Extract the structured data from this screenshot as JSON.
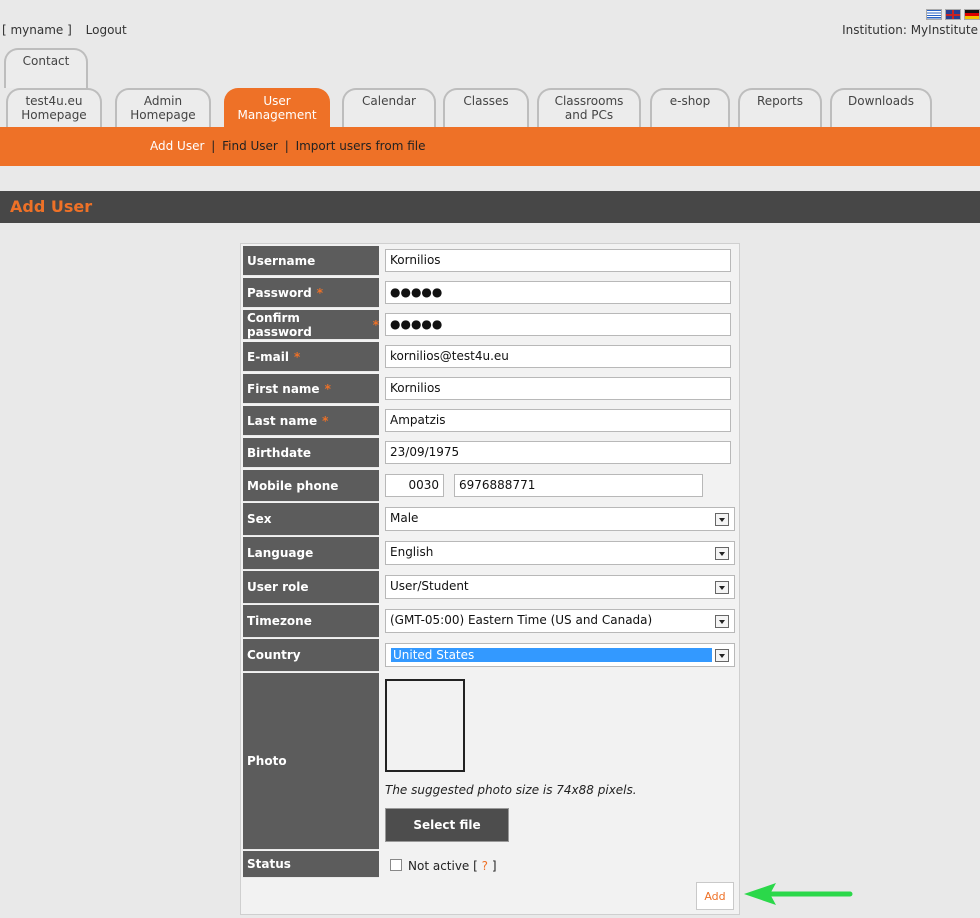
{
  "top": {
    "user": "[ myname ]",
    "logout": "Logout",
    "institution": "Institution: MyInstitute",
    "flags": [
      "greek-flag-icon",
      "english-flag-icon",
      "german-flag-icon"
    ]
  },
  "tabs": {
    "contact": "Contact",
    "items": [
      {
        "l1": "test4u.eu",
        "l2": "Homepage"
      },
      {
        "l1": "Admin",
        "l2": "Homepage"
      },
      {
        "l1": "User",
        "l2": "Management"
      },
      {
        "l1": "Calendar",
        "l2": ""
      },
      {
        "l1": "Classes",
        "l2": ""
      },
      {
        "l1": "Classrooms",
        "l2": "and PCs"
      },
      {
        "l1": "e-shop",
        "l2": ""
      },
      {
        "l1": "Reports",
        "l2": ""
      },
      {
        "l1": "Downloads",
        "l2": ""
      }
    ],
    "active_index": 2
  },
  "subnav": {
    "add_user": "Add User",
    "sep": "|",
    "find_user": "Find User",
    "import": "Import users from file"
  },
  "page": {
    "title": "Add User"
  },
  "form": {
    "required_mark": "*",
    "username": {
      "label": "Username",
      "value": "Kornilios"
    },
    "password": {
      "label": "Password",
      "value": "●●●●●"
    },
    "confirm": {
      "label": "Confirm password",
      "value": "●●●●●"
    },
    "email": {
      "label": "E-mail",
      "value": "kornilios@test4u.eu"
    },
    "first_name": {
      "label": "First name",
      "value": "Kornilios"
    },
    "last_name": {
      "label": "Last name",
      "value": "Ampatzis"
    },
    "birthdate": {
      "label": "Birthdate",
      "value": "23/09/1975"
    },
    "mobile": {
      "label": "Mobile phone",
      "code": "0030",
      "number": "6976888771"
    },
    "sex": {
      "label": "Sex",
      "value": "Male"
    },
    "language": {
      "label": "Language",
      "value": "English"
    },
    "role": {
      "label": "User role",
      "value": "User/Student"
    },
    "timezone": {
      "label": "Timezone",
      "value": "(GMT-05:00) Eastern Time (US and Canada)"
    },
    "country": {
      "label": "Country",
      "value": "United States"
    },
    "photo": {
      "label": "Photo",
      "note": "The suggested photo size is 74x88 pixels.",
      "button": "Select file"
    },
    "status": {
      "label": "Status",
      "text": "Not active [",
      "help": "?",
      "close": "]"
    },
    "add": "Add"
  },
  "colors": {
    "accent": "#ee7127",
    "label_bg": "#5c5c5c",
    "header_bg": "#474747",
    "annotation_arrow": "#2bd84a"
  }
}
